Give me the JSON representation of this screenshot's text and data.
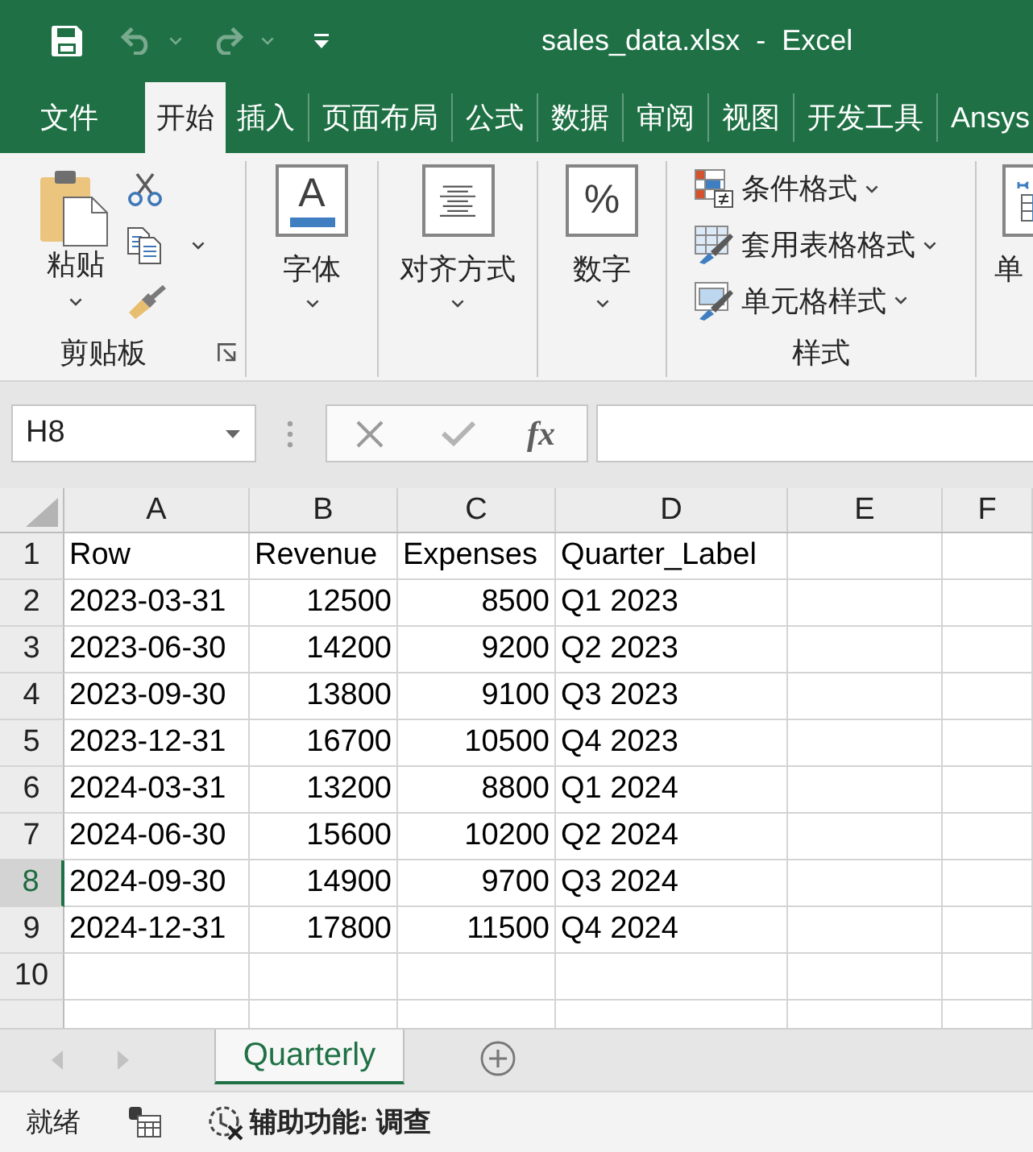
{
  "title_bar": {
    "quick_access": [
      {
        "kind": "save",
        "disabled": false
      },
      {
        "kind": "undo",
        "disabled": true
      },
      {
        "kind": "redo",
        "disabled": true
      },
      {
        "kind": "customize",
        "disabled": false
      }
    ],
    "title": "sales_data.xlsx  -  Excel"
  },
  "tabs": [
    {
      "label": "文件",
      "selected": false
    },
    {
      "label": "开始",
      "selected": true
    },
    {
      "label": "插入",
      "selected": false
    },
    {
      "label": "页面布局",
      "selected": false
    },
    {
      "label": "公式",
      "selected": false
    },
    {
      "label": "数据",
      "selected": false
    },
    {
      "label": "审阅",
      "selected": false
    },
    {
      "label": "视图",
      "selected": false
    },
    {
      "label": "开发工具",
      "selected": false
    },
    {
      "label": "Ansys",
      "selected": false
    }
  ],
  "ribbon": {
    "groups": [
      {
        "kind": "clipboard",
        "button": "粘贴",
        "label": "剪贴板"
      },
      {
        "kind": "font",
        "icon_text": "A",
        "button": "字体"
      },
      {
        "kind": "alignment",
        "button": "对齐方式"
      },
      {
        "kind": "number",
        "icon_text": "%",
        "button": "数字"
      },
      {
        "kind": "styles",
        "items": [
          {
            "kind": "conditional",
            "label": "条件格式"
          },
          {
            "kind": "table",
            "label": "套用表格格式"
          },
          {
            "kind": "cell",
            "label": "单元格样式"
          }
        ],
        "label": "样式"
      },
      {
        "kind": "cells",
        "button": "单"
      }
    ]
  },
  "formula_bar": {
    "name_box": "H8",
    "editing": false,
    "function_label": "fx"
  },
  "grid": {
    "columns": [
      "A",
      "B",
      "C",
      "D",
      "E",
      "F"
    ],
    "rows": [
      {
        "number": "1",
        "selected": false,
        "cells": [
          {
            "text": "Row",
            "kind": "text"
          },
          {
            "text": "Revenue",
            "kind": "text"
          },
          {
            "text": "Expenses",
            "kind": "text"
          },
          {
            "text": "Quarter_Label",
            "kind": "text"
          }
        ]
      },
      {
        "number": "2",
        "selected": false,
        "cells": [
          {
            "text": "2023-03-31",
            "kind": "text"
          },
          {
            "text": "12500",
            "kind": "number"
          },
          {
            "text": "8500",
            "kind": "number"
          },
          {
            "text": "Q1 2023",
            "kind": "text"
          }
        ]
      },
      {
        "number": "3",
        "selected": false,
        "cells": [
          {
            "text": "2023-06-30",
            "kind": "text"
          },
          {
            "text": "14200",
            "kind": "number"
          },
          {
            "text": "9200",
            "kind": "number"
          },
          {
            "text": "Q2 2023",
            "kind": "text"
          }
        ]
      },
      {
        "number": "4",
        "selected": false,
        "cells": [
          {
            "text": "2023-09-30",
            "kind": "text"
          },
          {
            "text": "13800",
            "kind": "number"
          },
          {
            "text": "9100",
            "kind": "number"
          },
          {
            "text": "Q3 2023",
            "kind": "text"
          }
        ]
      },
      {
        "number": "5",
        "selected": false,
        "cells": [
          {
            "text": "2023-12-31",
            "kind": "text"
          },
          {
            "text": "16700",
            "kind": "number"
          },
          {
            "text": "10500",
            "kind": "number"
          },
          {
            "text": "Q4 2023",
            "kind": "text"
          }
        ]
      },
      {
        "number": "6",
        "selected": false,
        "cells": [
          {
            "text": "2024-03-31",
            "kind": "text"
          },
          {
            "text": "13200",
            "kind": "number"
          },
          {
            "text": "8800",
            "kind": "number"
          },
          {
            "text": "Q1 2024",
            "kind": "text"
          }
        ]
      },
      {
        "number": "7",
        "selected": false,
        "cells": [
          {
            "text": "2024-06-30",
            "kind": "text"
          },
          {
            "text": "15600",
            "kind": "number"
          },
          {
            "text": "10200",
            "kind": "number"
          },
          {
            "text": "Q2 2024",
            "kind": "text"
          }
        ]
      },
      {
        "number": "8",
        "selected": true,
        "cells": [
          {
            "text": "2024-09-30",
            "kind": "text"
          },
          {
            "text": "14900",
            "kind": "number"
          },
          {
            "text": "9700",
            "kind": "number"
          },
          {
            "text": "Q3 2024",
            "kind": "text"
          }
        ]
      },
      {
        "number": "9",
        "selected": false,
        "cells": [
          {
            "text": "2024-12-31",
            "kind": "text"
          },
          {
            "text": "17800",
            "kind": "number"
          },
          {
            "text": "11500",
            "kind": "number"
          },
          {
            "text": "Q4 2024",
            "kind": "text"
          }
        ]
      },
      {
        "number": "10",
        "selected": false
      }
    ]
  },
  "sheet_tabs": {
    "nav_disabled": true,
    "tabs": [
      {
        "label": "Quarterly",
        "selected": true
      }
    ]
  },
  "status_bar": {
    "status": "就绪",
    "accessibility": "辅助功能: 调查"
  }
}
